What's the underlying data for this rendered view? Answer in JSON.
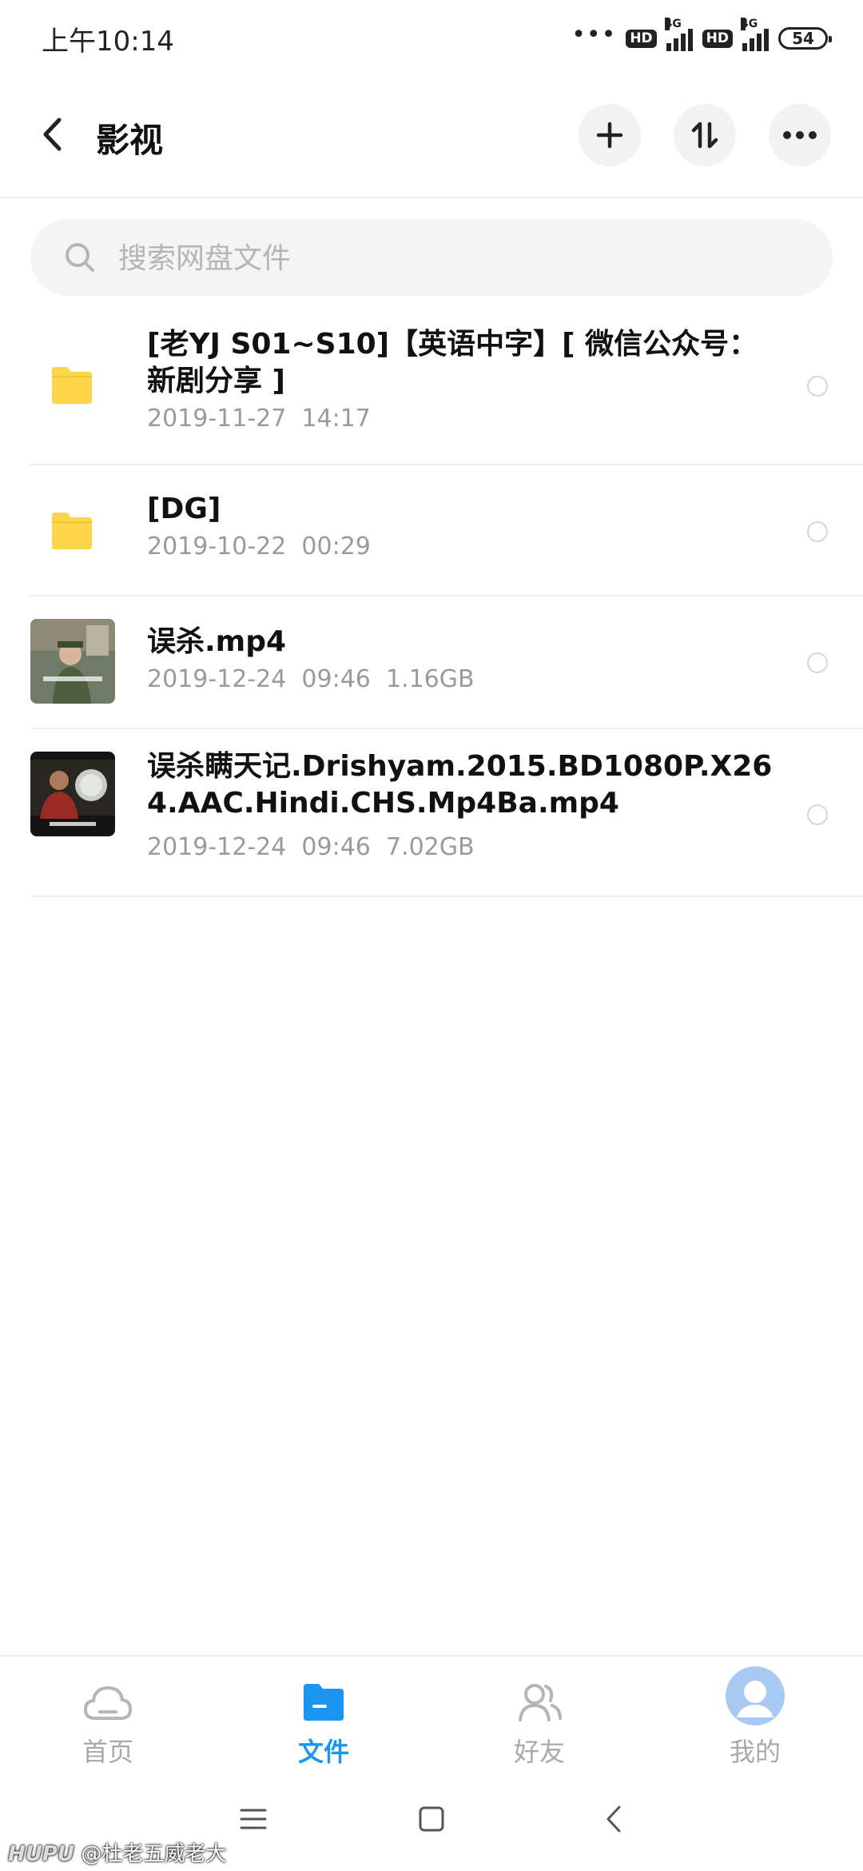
{
  "status_bar": {
    "time": "上午10:14",
    "battery": "54",
    "network_label": "4G",
    "hd_label": "HD",
    "dots": "•••"
  },
  "header": {
    "title": "影视"
  },
  "search": {
    "placeholder": "搜索网盘文件"
  },
  "files": [
    {
      "name": "[老YJ S01~S10]【英语中字】[ 微信公众号：新剧分享 ]",
      "date": "2019-11-27  14:17",
      "size": "",
      "type": "folder"
    },
    {
      "name": "[DG]",
      "date": "2019-10-22  00:29",
      "size": "",
      "type": "folder"
    },
    {
      "name": "误杀.mp4",
      "date": "2019-12-24  09:46",
      "size": "1.16GB",
      "type": "video"
    },
    {
      "name": "误杀瞒天记.Drishyam.2015.BD1080P.X264.AAC.Hindi.CHS.Mp4Ba.mp4",
      "date": "2019-12-24  09:46",
      "size": "7.02GB",
      "type": "video"
    }
  ],
  "bottom_nav": [
    {
      "label": "首页",
      "icon": "cloud-icon",
      "active": false
    },
    {
      "label": "文件",
      "icon": "folder-icon",
      "active": true
    },
    {
      "label": "好友",
      "icon": "friends-icon",
      "active": false
    },
    {
      "label": "我的",
      "icon": "avatar-icon",
      "active": false
    }
  ],
  "watermark": {
    "brand": "HUPU",
    "text": "@杜老五威老大"
  },
  "colors": {
    "accent": "#1a96f0",
    "folder": "#fdd54a",
    "muted": "#9a9a9a"
  }
}
